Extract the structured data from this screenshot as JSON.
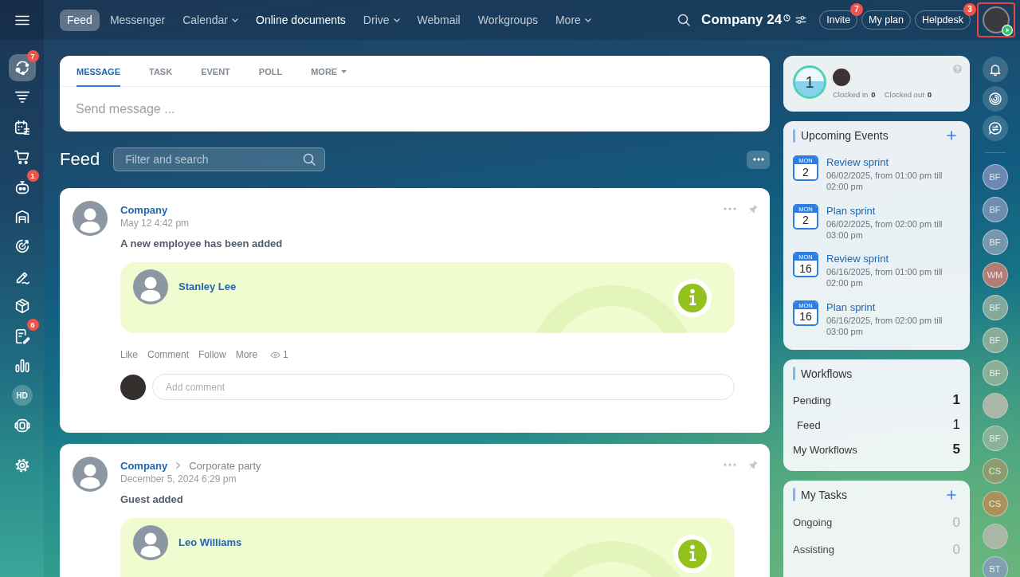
{
  "top_bar": {
    "items": [
      {
        "label": "Feed",
        "selected": true,
        "emphasized": false,
        "dropdown": false
      },
      {
        "label": "Messenger",
        "selected": false,
        "emphasized": false,
        "dropdown": false
      },
      {
        "label": "Calendar",
        "selected": false,
        "emphasized": false,
        "dropdown": true
      },
      {
        "label": "Online documents",
        "selected": false,
        "emphasized": true,
        "dropdown": false
      },
      {
        "label": "Drive",
        "selected": false,
        "emphasized": false,
        "dropdown": true
      },
      {
        "label": "Webmail",
        "selected": false,
        "emphasized": false,
        "dropdown": false
      },
      {
        "label": "Workgroups",
        "selected": false,
        "emphasized": false,
        "dropdown": false
      },
      {
        "label": "More",
        "selected": false,
        "emphasized": false,
        "dropdown": true
      }
    ],
    "portal_name": "Company 24",
    "buttons": [
      {
        "label": "Invite",
        "badge": "7"
      },
      {
        "label": "My plan"
      },
      {
        "label": "Helpdesk",
        "badge": "3"
      }
    ],
    "user_avatar": {
      "highlighted": true
    }
  },
  "left_sidebar": {
    "items": [
      {
        "kind": "icon",
        "selected": true,
        "badge": "7"
      },
      {
        "kind": "icon",
        "selected": false
      },
      {
        "kind": "icon",
        "selected": false
      },
      {
        "kind": "icon",
        "selected": false
      },
      {
        "kind": "icon",
        "selected": false,
        "badge": "1"
      },
      {
        "kind": "icon",
        "selected": false
      },
      {
        "kind": "icon",
        "selected": false
      },
      {
        "kind": "icon",
        "selected": false
      },
      {
        "kind": "icon",
        "selected": false
      },
      {
        "kind": "icon",
        "selected": false,
        "badge": "6"
      },
      {
        "kind": "icon",
        "selected": false
      },
      {
        "kind": "initials",
        "label": "HD",
        "selected": false
      },
      {
        "kind": "icon",
        "selected": false
      },
      {
        "kind": "icon",
        "selected": false
      }
    ]
  },
  "composer": {
    "tabs": [
      {
        "label": "MESSAGE",
        "selected": true,
        "dropdown": false
      },
      {
        "label": "TASK",
        "selected": false,
        "dropdown": false
      },
      {
        "label": "EVENT",
        "selected": false,
        "dropdown": false
      },
      {
        "label": "POLL",
        "selected": false,
        "dropdown": false
      },
      {
        "label": "MORE",
        "selected": false,
        "dropdown": true
      }
    ],
    "placeholder": "Send message ..."
  },
  "feed": {
    "heading": "Feed",
    "filter": {
      "placeholder": "Filter and search"
    },
    "posts": [
      {
        "author": "Company",
        "date": "May 12 4:42 pm",
        "title": "A new employee has been added",
        "person": "Stanley Lee",
        "actions": [
          "Like",
          "Comment",
          "Follow",
          "More"
        ],
        "views": "1",
        "comment": {
          "placeholder": "Add comment"
        }
      },
      {
        "author": "Company",
        "destination": "Corporate party",
        "date": "December 5, 2024 6:29 pm",
        "title": "Guest added",
        "person": "Leo Williams"
      }
    ]
  },
  "time_card": {
    "counter": "1",
    "stats": [
      {
        "label": "Clocked in",
        "value": "0"
      },
      {
        "label": "Clocked out",
        "value": "0"
      }
    ]
  },
  "events": {
    "title": "Upcoming Events",
    "add_button": true,
    "items": [
      {
        "weekday": "MON",
        "day": "2",
        "name": "Review sprint",
        "time": "06/02/2025, from 01:00 pm till 02:00 pm"
      },
      {
        "weekday": "MON",
        "day": "2",
        "name": "Plan sprint",
        "time": "06/02/2025, from 02:00 pm till 03:00 pm"
      },
      {
        "weekday": "MON",
        "day": "16",
        "name": "Review sprint",
        "time": "06/16/2025, from 01:00 pm till 02:00 pm"
      },
      {
        "weekday": "MON",
        "day": "16",
        "name": "Plan sprint",
        "time": "06/16/2025, from 02:00 pm till 03:00 pm"
      }
    ]
  },
  "workflows": {
    "title": "Workflows",
    "rows": [
      {
        "kind": "total",
        "label": "Pending",
        "value": "1"
      },
      {
        "kind": "sub",
        "label": "Feed",
        "value": "1"
      },
      {
        "kind": "total",
        "label": "My Workflows",
        "value": "5"
      }
    ]
  },
  "tasks": {
    "title": "My Tasks",
    "add_button": true,
    "rows": [
      {
        "kind": "empty",
        "label": "Ongoing",
        "value": "0"
      },
      {
        "kind": "empty",
        "label": "Assisting",
        "value": "0"
      }
    ]
  },
  "rail": {
    "avatars": [
      {
        "kind": "initials",
        "label": "BF",
        "color": "#6d89b3"
      },
      {
        "kind": "initials",
        "label": "BF",
        "color": "#6e8db1"
      },
      {
        "kind": "initials",
        "label": "BF",
        "color": "#7697ad"
      },
      {
        "kind": "initials",
        "label": "WM",
        "color": "#b27c77"
      },
      {
        "kind": "initials",
        "label": "BF",
        "color": "#84a89c"
      },
      {
        "kind": "initials",
        "label": "BF",
        "color": "#87ac98"
      },
      {
        "kind": "initials",
        "label": "BF",
        "color": "#8aaf97"
      },
      {
        "kind": "photo"
      },
      {
        "kind": "initials",
        "label": "BF",
        "color": "#89b299"
      },
      {
        "kind": "initials",
        "label": "CS",
        "color": "#8b9c6f"
      },
      {
        "kind": "initials",
        "label": "CS",
        "color": "#a8925a"
      },
      {
        "kind": "photo"
      },
      {
        "kind": "initials",
        "label": "BT",
        "color": "#819fb0"
      }
    ]
  }
}
